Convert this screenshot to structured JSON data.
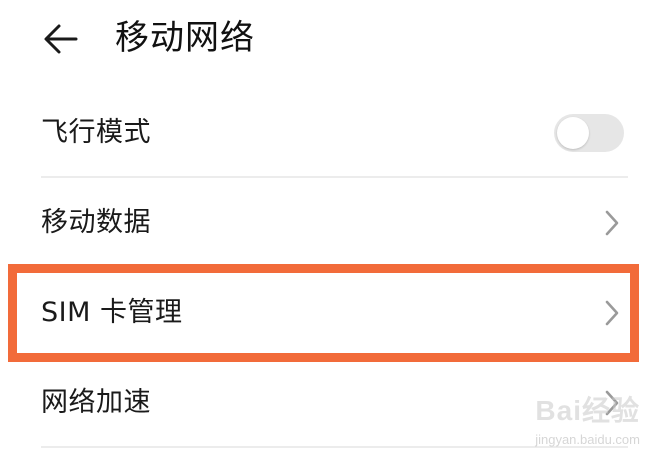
{
  "header": {
    "back_icon": "arrow-left-icon",
    "title": "移动网络"
  },
  "settings": {
    "airplane_mode": {
      "label": "飞行模式",
      "enabled": false
    },
    "mobile_data": {
      "label": "移动数据"
    },
    "sim_management": {
      "label": "SIM 卡管理",
      "highlighted": true
    },
    "network_acceleration": {
      "label": "网络加速"
    }
  },
  "colors": {
    "highlight": "#f26b3a",
    "toggle_off": "#e6e6e6",
    "chevron": "#9a9a9a"
  },
  "watermark": {
    "logo": "Bai经验",
    "url": "jingyan.baidu.com"
  }
}
